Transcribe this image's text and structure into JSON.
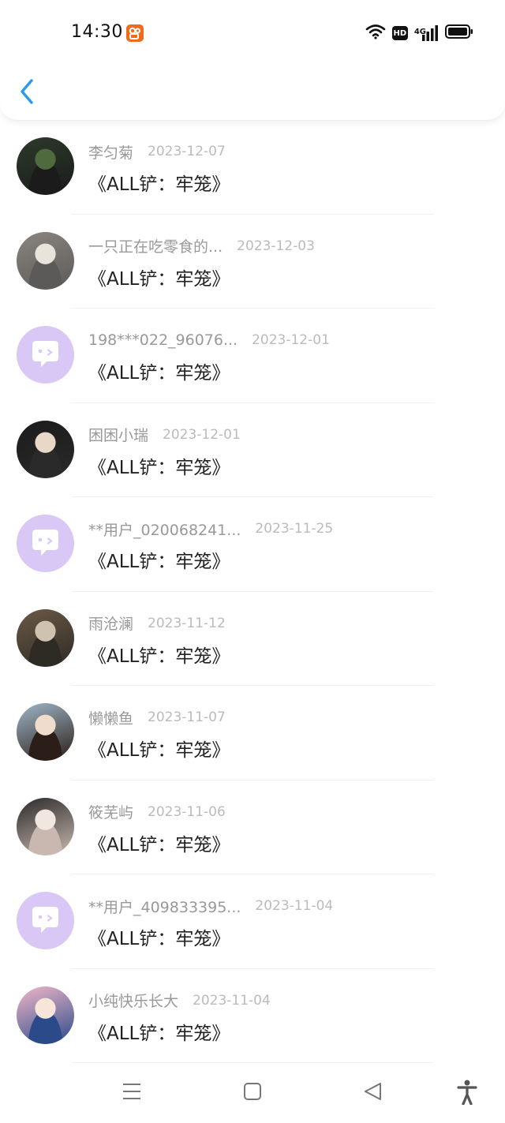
{
  "status_bar": {
    "time": "14:30",
    "app_icon": "kuaishou-app-icon",
    "net_label": "4G",
    "hd_label": "HD",
    "icons": [
      "wifi-icon",
      "hd-icon",
      "signal-icon",
      "battery-icon"
    ]
  },
  "header": {
    "back_icon": "chevron-left-icon",
    "accent": "#2b9be8"
  },
  "items": [
    {
      "name": "李匀菊",
      "date": "2023-12-07",
      "title": "《ALL铲：牢笼》",
      "avatar": "photo"
    },
    {
      "name": "一只正在吃零食的...",
      "date": "2023-12-03",
      "title": "《ALL铲：牢笼》",
      "avatar": "photo"
    },
    {
      "name": "198***022_96076...",
      "date": "2023-12-01",
      "title": "《ALL铲：牢笼》",
      "avatar": "default"
    },
    {
      "name": "困困小瑞",
      "date": "2023-12-01",
      "title": "《ALL铲：牢笼》",
      "avatar": "photo"
    },
    {
      "name": "**用户_020068241...",
      "date": "2023-11-25",
      "title": "《ALL铲：牢笼》",
      "avatar": "default"
    },
    {
      "name": "雨沧澜",
      "date": "2023-11-12",
      "title": "《ALL铲：牢笼》",
      "avatar": "photo"
    },
    {
      "name": "懒懒鱼",
      "date": "2023-11-07",
      "title": "《ALL铲：牢笼》",
      "avatar": "photo"
    },
    {
      "name": "筱芜屿",
      "date": "2023-11-06",
      "title": "《ALL铲：牢笼》",
      "avatar": "photo"
    },
    {
      "name": "**用户_409833395...",
      "date": "2023-11-04",
      "title": "《ALL铲：牢笼》",
      "avatar": "default"
    },
    {
      "name": "小纯快乐长大",
      "date": "2023-11-04",
      "title": "《ALL铲：牢笼》",
      "avatar": "photo"
    }
  ],
  "colors": {
    "default_avatar_bg": "#d9c8f5",
    "name_text": "#999999",
    "date_text": "#bbbbbb",
    "title_text": "#222222"
  },
  "nav_bar": {
    "icons": [
      "menu-icon",
      "home-square-icon",
      "back-triangle-icon",
      "accessibility-icon"
    ]
  }
}
